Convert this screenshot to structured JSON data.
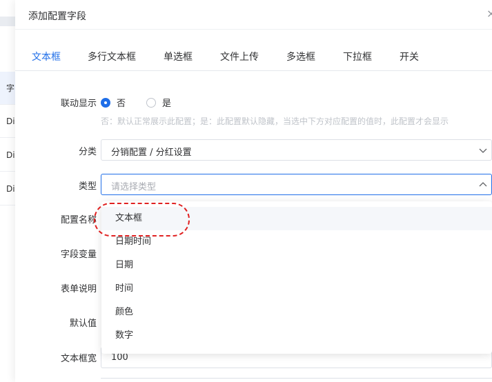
{
  "background": {
    "rows": [
      {
        "label": "字",
        "highlight": true
      },
      {
        "label": "Div",
        "highlight": false
      },
      {
        "label": "Div",
        "highlight": false
      },
      {
        "label": "Div",
        "highlight": false
      }
    ]
  },
  "drawer": {
    "title": "添加配置字段",
    "close_icon": "×"
  },
  "tabs": [
    {
      "label": "文本框",
      "active": true
    },
    {
      "label": "多行文本框",
      "active": false
    },
    {
      "label": "单选框",
      "active": false
    },
    {
      "label": "文件上传",
      "active": false
    },
    {
      "label": "多选框",
      "active": false
    },
    {
      "label": "下拉框",
      "active": false
    },
    {
      "label": "开关",
      "active": false
    }
  ],
  "form": {
    "linkage": {
      "label": "联动显示",
      "options": [
        {
          "label": "否",
          "checked": true
        },
        {
          "label": "是",
          "checked": false
        }
      ],
      "hint": "否：默认正常展示此配置；是：此配置默认隐藏，当选中下方对应配置的值时，此配置才会显示"
    },
    "category": {
      "label": "分类",
      "value": "分销配置 / 分红设置"
    },
    "type": {
      "label": "类型",
      "placeholder": "请选择类型"
    },
    "config_name": {
      "label": "配置名称"
    },
    "field_var": {
      "label": "字段变量"
    },
    "form_desc": {
      "label": "表单说明"
    },
    "default_value": {
      "label": "默认值"
    },
    "textbox_width": {
      "label": "文本框宽",
      "value": "100"
    }
  },
  "dropdown": {
    "options": [
      "文本框",
      "日期时间",
      "日期",
      "时间",
      "颜色",
      "数字"
    ],
    "hovered_index": 0
  },
  "colors": {
    "accent": "#1f6ee8",
    "annotation": "#e02020"
  }
}
